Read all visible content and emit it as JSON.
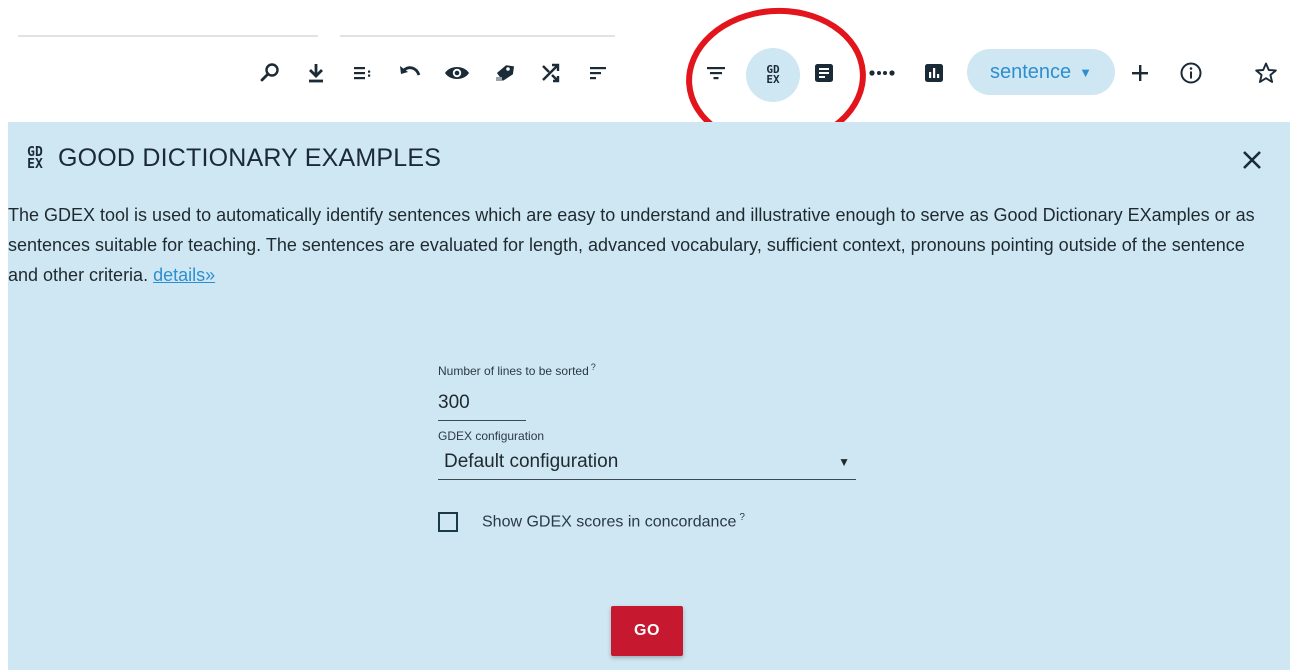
{
  "toolbar": {
    "icons": [
      "search-icon",
      "download-icon",
      "lines-menu-icon",
      "undo-icon",
      "eye-icon",
      "tag-icon",
      "shuffle-icon",
      "sort-icon",
      "filter-icon",
      "gdex-icon",
      "document-icon",
      "dots-icon",
      "bar-chart-icon",
      "plus-icon",
      "info-icon",
      "star-icon"
    ],
    "gdex_badge": "GD\nEX",
    "context_chip": "sentence",
    "annotation_color": "#e2151d"
  },
  "panel": {
    "icon_glyph": "GD\nEX",
    "title": "GOOD DICTIONARY EXAMPLES",
    "description": "The GDEX tool is used to automatically identify sentences which are easy to understand and illustrative enough to serve as Good Dictionary EXamples or as sentences suitable for teaching. The sentences are evaluated for length, advanced vocabulary, sufficient context, pronouns pointing outside of the sentence and other criteria.",
    "details_link": "details»",
    "background": "#cfe7f2"
  },
  "form": {
    "lines_label": "Number of lines to be sorted",
    "lines_value": "300",
    "config_label": "GDEX configuration",
    "config_value": "Default configuration",
    "show_scores_label": "Show GDEX scores in concordance",
    "show_scores_checked": false,
    "help_mark": "?"
  },
  "actions": {
    "go_label": "GO",
    "go_color": "#c6192f"
  }
}
